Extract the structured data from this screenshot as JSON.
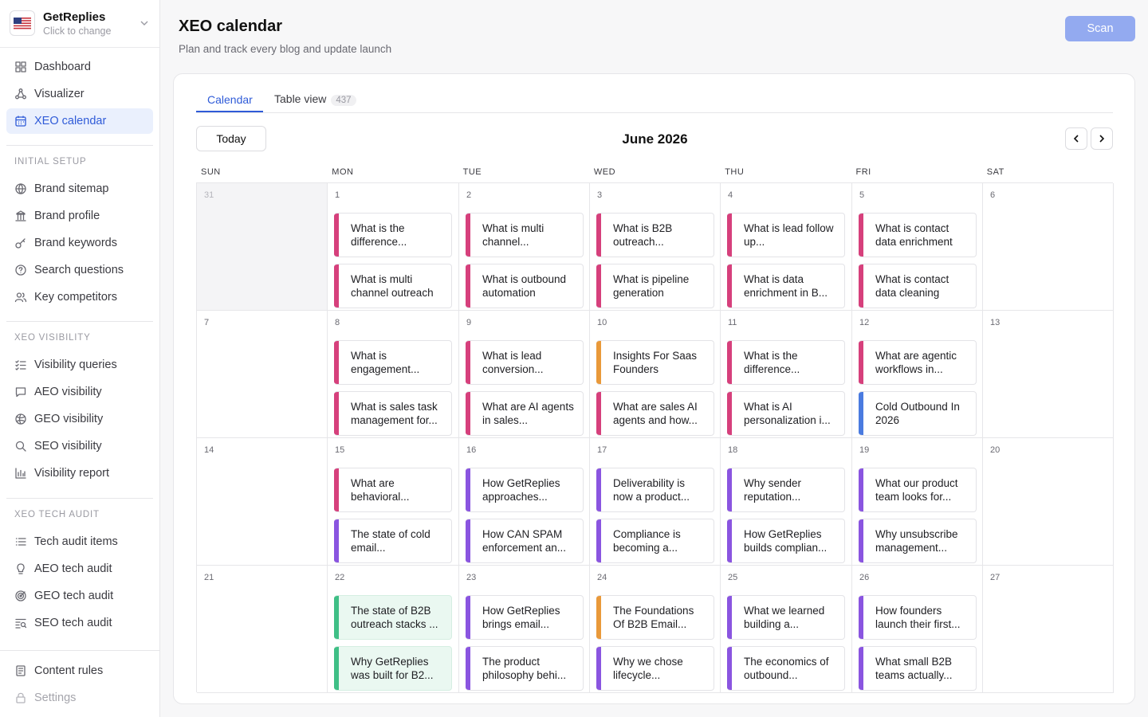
{
  "brand": {
    "name": "GetReplies",
    "sub": "Click to change"
  },
  "nav_top": [
    {
      "label": "Dashboard",
      "icon": "dashboard-icon"
    },
    {
      "label": "Visualizer",
      "icon": "visualizer-icon"
    },
    {
      "label": "XEO calendar",
      "icon": "calendar-icon",
      "active": true
    }
  ],
  "sections": [
    {
      "label": "INITIAL SETUP",
      "items": [
        {
          "label": "Brand sitemap",
          "icon": "globe-icon"
        },
        {
          "label": "Brand profile",
          "icon": "building-icon"
        },
        {
          "label": "Brand keywords",
          "icon": "key-icon"
        },
        {
          "label": "Search questions",
          "icon": "question-icon"
        },
        {
          "label": "Key competitors",
          "icon": "users-icon"
        }
      ]
    },
    {
      "label": "XEO VISIBILITY",
      "items": [
        {
          "label": "Visibility queries",
          "icon": "list-check-icon"
        },
        {
          "label": "AEO visibility",
          "icon": "chat-icon"
        },
        {
          "label": "GEO visibility",
          "icon": "globe-grid-icon"
        },
        {
          "label": "SEO visibility",
          "icon": "search-icon"
        },
        {
          "label": "Visibility report",
          "icon": "bar-chart-icon"
        }
      ]
    },
    {
      "label": "XEO TECH AUDIT",
      "items": [
        {
          "label": "Tech audit items",
          "icon": "list-icon"
        },
        {
          "label": "AEO tech audit",
          "icon": "lightbulb-icon"
        },
        {
          "label": "GEO tech audit",
          "icon": "target-icon"
        },
        {
          "label": "SEO tech audit",
          "icon": "search-list-icon"
        }
      ]
    }
  ],
  "nav_bottom": [
    {
      "label": "Content rules",
      "icon": "rules-icon"
    },
    {
      "label": "Settings",
      "icon": "lock-icon",
      "muted": true
    }
  ],
  "header": {
    "title": "XEO calendar",
    "subtitle": "Plan and track every blog and update launch",
    "scan_label": "Scan"
  },
  "tabs": {
    "calendar": "Calendar",
    "table": "Table view",
    "table_count": "437"
  },
  "calendar": {
    "today_label": "Today",
    "month": "June 2026",
    "weekdays": [
      "SUN",
      "MON",
      "TUE",
      "WED",
      "THU",
      "FRI",
      "SAT"
    ],
    "weeks": [
      [
        {
          "day": "31",
          "other": true,
          "events": []
        },
        {
          "day": "1",
          "events": [
            {
              "text": "What is the difference...",
              "color": "#d6407c"
            },
            {
              "text": "What is multi channel outreach",
              "color": "#d6407c"
            }
          ]
        },
        {
          "day": "2",
          "events": [
            {
              "text": "What is multi channel...",
              "color": "#d6407c"
            },
            {
              "text": "What is outbound automation",
              "color": "#d6407c"
            }
          ]
        },
        {
          "day": "3",
          "events": [
            {
              "text": "What is B2B outreach...",
              "color": "#d6407c"
            },
            {
              "text": "What is pipeline generation",
              "color": "#d6407c"
            }
          ]
        },
        {
          "day": "4",
          "events": [
            {
              "text": "What is lead follow up...",
              "color": "#d6407c"
            },
            {
              "text": "What is data enrichment in B...",
              "color": "#d6407c"
            }
          ]
        },
        {
          "day": "5",
          "events": [
            {
              "text": "What is contact data enrichment",
              "color": "#d6407c"
            },
            {
              "text": "What is contact data cleaning",
              "color": "#d6407c"
            }
          ]
        },
        {
          "day": "6",
          "events": []
        }
      ],
      [
        {
          "day": "7",
          "events": []
        },
        {
          "day": "8",
          "events": [
            {
              "text": "What is engagement...",
              "color": "#d6407c"
            },
            {
              "text": "What is sales task management for...",
              "color": "#d6407c"
            }
          ]
        },
        {
          "day": "9",
          "events": [
            {
              "text": "What is lead conversion...",
              "color": "#d6407c"
            },
            {
              "text": "What are AI agents in sales...",
              "color": "#d6407c"
            }
          ]
        },
        {
          "day": "10",
          "events": [
            {
              "text": "Insights For Saas Founders",
              "color": "#e9993a"
            },
            {
              "text": "What are sales AI agents and how...",
              "color": "#d6407c"
            }
          ]
        },
        {
          "day": "11",
          "events": [
            {
              "text": "What is the difference...",
              "color": "#d6407c"
            },
            {
              "text": "What is AI personalization i...",
              "color": "#d6407c"
            }
          ]
        },
        {
          "day": "12",
          "events": [
            {
              "text": "What are agentic workflows in...",
              "color": "#d6407c"
            },
            {
              "text": "Cold Outbound In 2026",
              "color": "#4a7be0"
            }
          ]
        },
        {
          "day": "13",
          "events": []
        }
      ],
      [
        {
          "day": "14",
          "events": []
        },
        {
          "day": "15",
          "events": [
            {
              "text": "What are behavioral...",
              "color": "#d6407c"
            },
            {
              "text": "The state of cold email...",
              "color": "#8a55e0"
            }
          ]
        },
        {
          "day": "16",
          "events": [
            {
              "text": "How GetReplies approaches...",
              "color": "#8a55e0"
            },
            {
              "text": "How CAN SPAM enforcement an...",
              "color": "#8a55e0"
            }
          ]
        },
        {
          "day": "17",
          "events": [
            {
              "text": "Deliverability is now a product...",
              "color": "#8a55e0"
            },
            {
              "text": "Compliance is becoming a...",
              "color": "#8a55e0"
            }
          ]
        },
        {
          "day": "18",
          "events": [
            {
              "text": "Why sender reputation...",
              "color": "#8a55e0"
            },
            {
              "text": "How GetReplies builds complian...",
              "color": "#8a55e0"
            }
          ]
        },
        {
          "day": "19",
          "events": [
            {
              "text": "What our product team looks for...",
              "color": "#8a55e0"
            },
            {
              "text": "Why unsubscribe management...",
              "color": "#8a55e0"
            }
          ]
        },
        {
          "day": "20",
          "events": []
        }
      ],
      [
        {
          "day": "21",
          "events": []
        },
        {
          "day": "22",
          "events": [
            {
              "text": "The state of B2B outreach stacks ...",
              "color": "#3fbf86",
              "green": true
            },
            {
              "text": "Why GetReplies was built for B2...",
              "color": "#3fbf86",
              "green": true
            }
          ]
        },
        {
          "day": "23",
          "events": [
            {
              "text": "How GetReplies brings email...",
              "color": "#8a55e0"
            },
            {
              "text": "The product philosophy behi...",
              "color": "#8a55e0"
            }
          ]
        },
        {
          "day": "24",
          "events": [
            {
              "text": "The Foundations Of B2B Email...",
              "color": "#e9993a"
            },
            {
              "text": "Why we chose lifecycle...",
              "color": "#8a55e0"
            }
          ]
        },
        {
          "day": "25",
          "events": [
            {
              "text": "What we learned building a...",
              "color": "#8a55e0"
            },
            {
              "text": "The economics of outbound...",
              "color": "#8a55e0"
            }
          ]
        },
        {
          "day": "26",
          "events": [
            {
              "text": "How founders launch their first...",
              "color": "#8a55e0"
            },
            {
              "text": "What small B2B teams actually...",
              "color": "#8a55e0"
            }
          ]
        },
        {
          "day": "27",
          "events": []
        }
      ]
    ]
  }
}
